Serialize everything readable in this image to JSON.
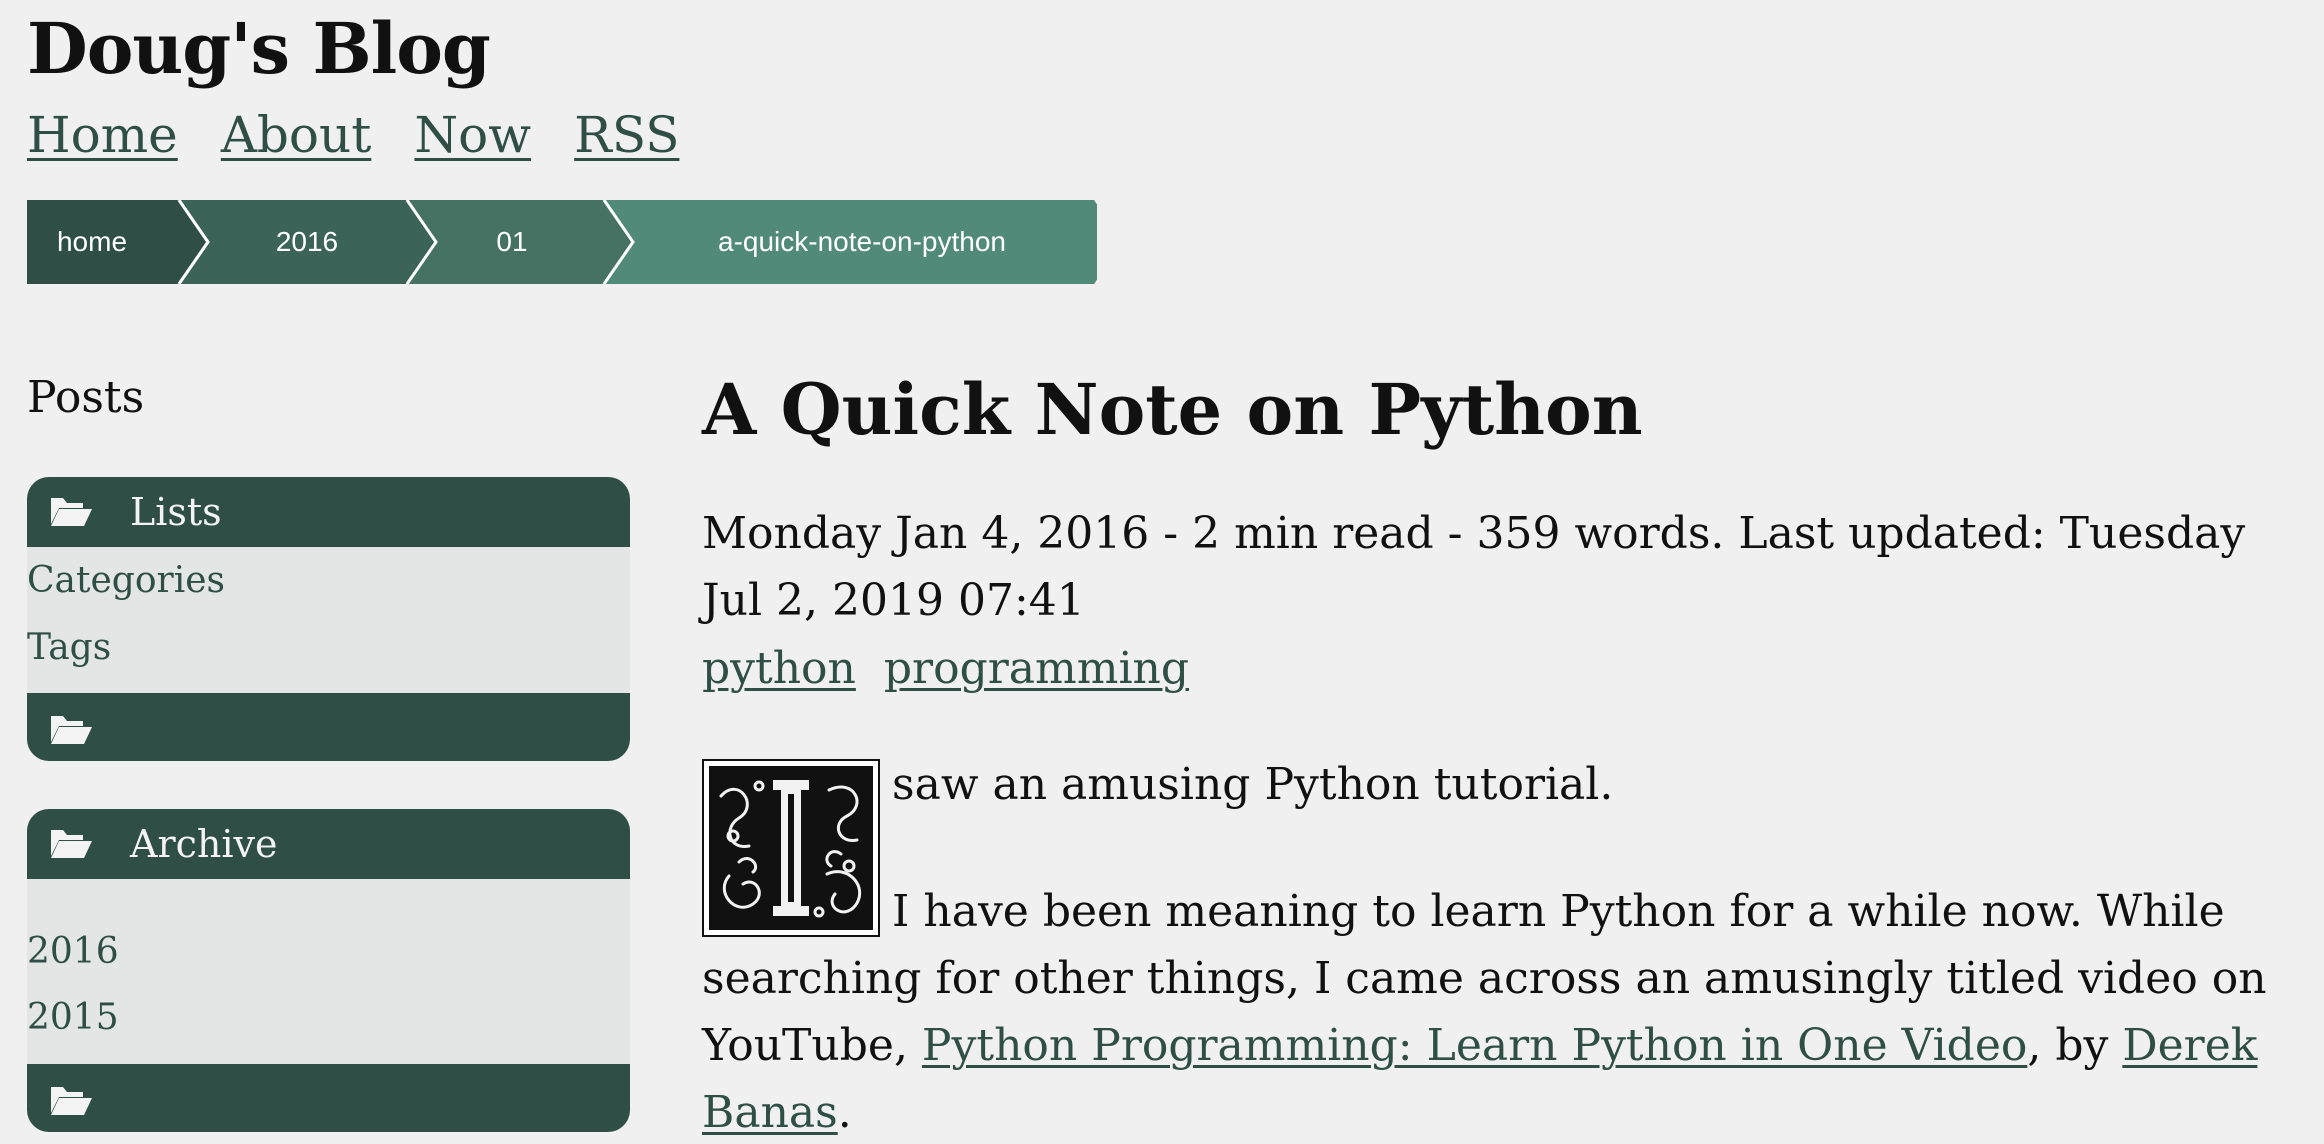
{
  "site": {
    "title": "Doug's Blog",
    "nav": [
      "Home",
      "About",
      "Now",
      "RSS"
    ]
  },
  "breadcrumb": [
    "home",
    "2016",
    "01",
    "a-quick-note-on-python"
  ],
  "sidebar": {
    "heading": "Posts",
    "lists": {
      "title": "Lists",
      "items": [
        "Categories",
        "Tags"
      ]
    },
    "archive": {
      "title": "Archive",
      "items": [
        "2016",
        "2015"
      ]
    }
  },
  "article": {
    "title": "A Quick Note on Python",
    "meta": "Monday Jan 4, 2016 - 2 min read - 359 words. Last updated: Tuesday Jul 2, 2019 07:41",
    "tags": [
      "python",
      "programming"
    ],
    "first_line": "saw an amusing Python tutorial.",
    "body": {
      "text_before": "I have been meaning to learn Python for a while now. While searching for other things, I came across an amusingly titled video on YouTube, ",
      "video_link": "Python Programming: Learn Python in One Video",
      "text_between": ", by ",
      "author_link": "Derek Banas",
      "text_after": "."
    }
  },
  "colors": {
    "background": "#f0f0f0",
    "panel_dark": "#2f4f46",
    "panel_body": "#e3e6e5",
    "link": "#2f4f46",
    "crumb_1": "#2f4f46",
    "crumb_2": "#3c6358",
    "crumb_3": "#467263",
    "crumb_4": "#528a79"
  },
  "icons": {
    "panel_toggle": "folder-open-icon",
    "drop_cap": "ornate-letter-I-icon"
  }
}
